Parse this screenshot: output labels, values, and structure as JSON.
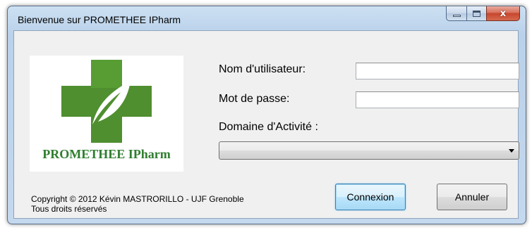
{
  "window": {
    "title": "Bienvenue sur PROMETHEE IPharm",
    "minimize_icon": "minimize-icon",
    "maximize_icon": "maximize-icon",
    "close_icon": "close-icon",
    "close_glyph": "x"
  },
  "logo": {
    "text": "PROMETHEE IPharm",
    "icon": "green-cross-leaf-logo",
    "colors": {
      "cross": "#4f8f2f",
      "leaf": "#ffffff",
      "text": "#2e7d2e"
    }
  },
  "form": {
    "username_label": "Nom d'utilisateur:",
    "username_value": "",
    "password_label": "Mot de passe:",
    "password_value": "",
    "domain_label": "Domaine d'Activité :",
    "domain_value": "",
    "dropdown_icon": "chevron-down-icon"
  },
  "buttons": {
    "connect": "Connexion",
    "cancel": "Annuler"
  },
  "footer": {
    "copyright": "Copyright © 2012 Kévin MASTRORILLO - UJF Grenoble",
    "rights": "Tous droits réservés"
  }
}
